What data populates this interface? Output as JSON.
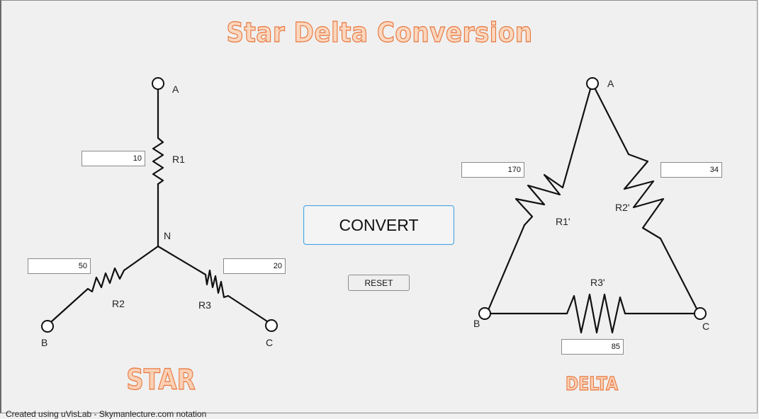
{
  "title": "Star Delta Conversion",
  "star": {
    "label": "STAR",
    "nodes": {
      "a": "A",
      "b": "B",
      "c": "C",
      "n": "N"
    },
    "resistors": {
      "r1": "R1",
      "r2": "R2",
      "r3": "R3"
    },
    "values": {
      "r1": "10",
      "r2": "50",
      "r3": "20"
    }
  },
  "delta": {
    "label": "DELTA",
    "nodes": {
      "a": "A",
      "b": "B",
      "c": "C"
    },
    "resistors": {
      "r1": "R1'",
      "r2": "R2'",
      "r3": "R3'"
    },
    "values": {
      "r1": "170",
      "r2": "34",
      "r3": "85"
    }
  },
  "buttons": {
    "convert": "CONVERT",
    "reset": "RESET"
  },
  "footer": "Created using uVisLab - Skymanlecture.com notation",
  "colors": {
    "title_fill": "#fbd7be",
    "title_stroke": "#e8743a",
    "convert_border": "#4aa3df"
  }
}
